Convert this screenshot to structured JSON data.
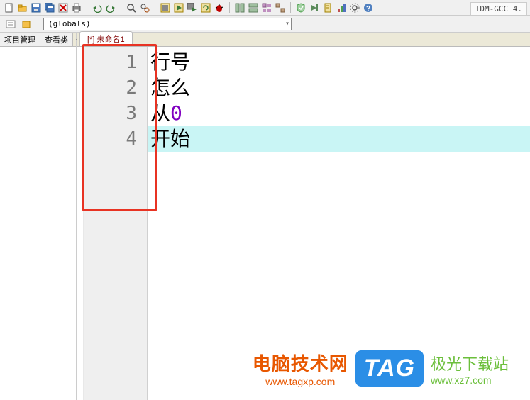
{
  "compiler_label": "TDM-GCC 4.",
  "globals_combo": "(globals)",
  "sidebar": {
    "tab1": "项目管理",
    "tab2": "查看类"
  },
  "file_tab": "[*] 未命名1",
  "editor": {
    "lines": [
      {
        "num": "1",
        "text": "行号"
      },
      {
        "num": "2",
        "text": "怎么"
      },
      {
        "num": "3",
        "prefix": "从",
        "zero": "0",
        "suffix": ""
      },
      {
        "num": "4",
        "text": "开始"
      }
    ]
  },
  "watermark1": {
    "title": "电脑技术网",
    "url": "www.tagxp.com"
  },
  "tag_badge": "TAG",
  "watermark2": {
    "title": "极光下载站",
    "url": "www.xz7.com"
  }
}
